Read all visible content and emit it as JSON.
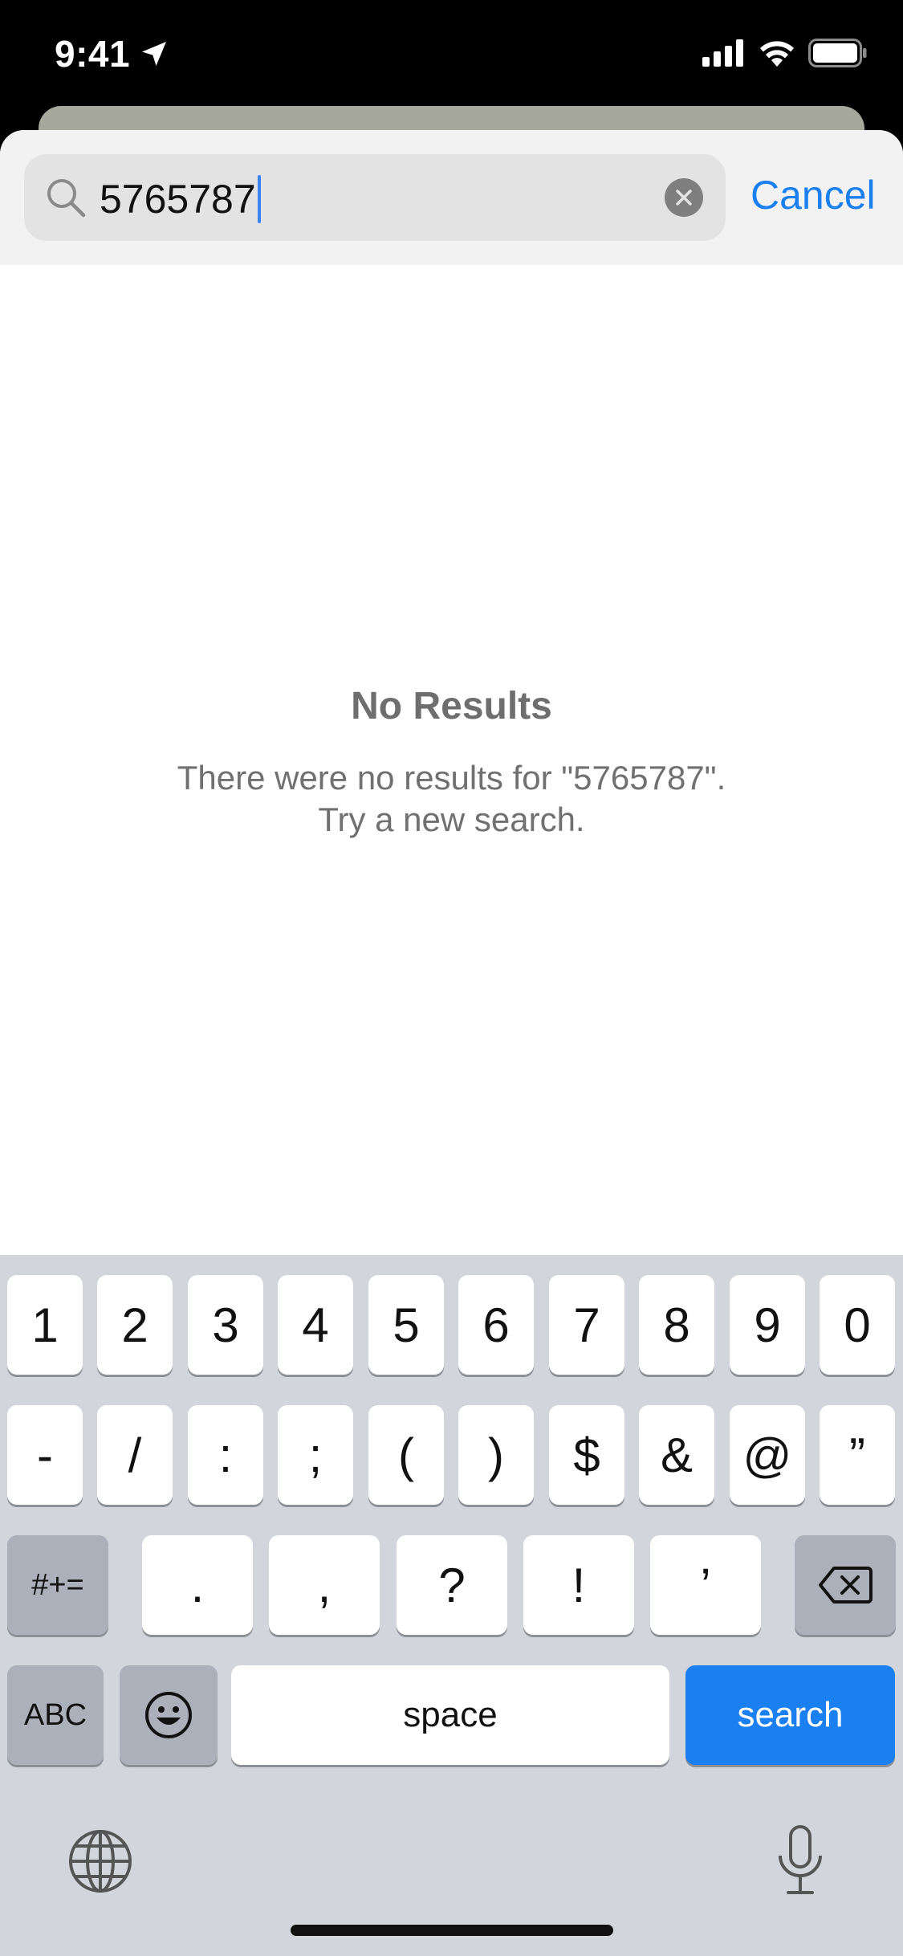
{
  "status_bar": {
    "time": "9:41"
  },
  "search": {
    "value": "5765787",
    "cancel_label": "Cancel"
  },
  "empty_state": {
    "title": "No Results",
    "line1": "There were no results for \"5765787\".",
    "line2": "Try a new search."
  },
  "keyboard": {
    "row1": [
      "1",
      "2",
      "3",
      "4",
      "5",
      "6",
      "7",
      "8",
      "9",
      "0"
    ],
    "row2": [
      "-",
      "/",
      ":",
      ";",
      "(",
      ")",
      "$",
      "&",
      "@",
      "”"
    ],
    "row3": [
      "#+=",
      ".",
      ",",
      "?",
      "!",
      "’"
    ],
    "abc_label": "ABC",
    "space_label": "space",
    "search_label": "search"
  },
  "colors": {
    "accent": "#1a7ff0",
    "keyboard_bg": "#d2d5dc"
  }
}
